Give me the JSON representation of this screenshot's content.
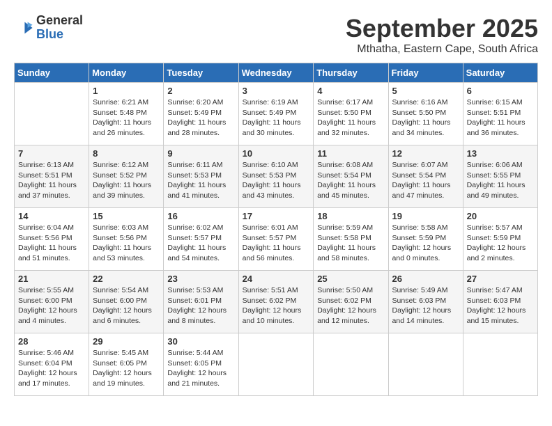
{
  "header": {
    "logo_general": "General",
    "logo_blue": "Blue",
    "month": "September 2025",
    "location": "Mthatha, Eastern Cape, South Africa"
  },
  "weekdays": [
    "Sunday",
    "Monday",
    "Tuesday",
    "Wednesday",
    "Thursday",
    "Friday",
    "Saturday"
  ],
  "weeks": [
    [
      {
        "day": "",
        "info": ""
      },
      {
        "day": "1",
        "info": "Sunrise: 6:21 AM\nSunset: 5:48 PM\nDaylight: 11 hours\nand 26 minutes."
      },
      {
        "day": "2",
        "info": "Sunrise: 6:20 AM\nSunset: 5:49 PM\nDaylight: 11 hours\nand 28 minutes."
      },
      {
        "day": "3",
        "info": "Sunrise: 6:19 AM\nSunset: 5:49 PM\nDaylight: 11 hours\nand 30 minutes."
      },
      {
        "day": "4",
        "info": "Sunrise: 6:17 AM\nSunset: 5:50 PM\nDaylight: 11 hours\nand 32 minutes."
      },
      {
        "day": "5",
        "info": "Sunrise: 6:16 AM\nSunset: 5:50 PM\nDaylight: 11 hours\nand 34 minutes."
      },
      {
        "day": "6",
        "info": "Sunrise: 6:15 AM\nSunset: 5:51 PM\nDaylight: 11 hours\nand 36 minutes."
      }
    ],
    [
      {
        "day": "7",
        "info": "Sunrise: 6:13 AM\nSunset: 5:51 PM\nDaylight: 11 hours\nand 37 minutes."
      },
      {
        "day": "8",
        "info": "Sunrise: 6:12 AM\nSunset: 5:52 PM\nDaylight: 11 hours\nand 39 minutes."
      },
      {
        "day": "9",
        "info": "Sunrise: 6:11 AM\nSunset: 5:53 PM\nDaylight: 11 hours\nand 41 minutes."
      },
      {
        "day": "10",
        "info": "Sunrise: 6:10 AM\nSunset: 5:53 PM\nDaylight: 11 hours\nand 43 minutes."
      },
      {
        "day": "11",
        "info": "Sunrise: 6:08 AM\nSunset: 5:54 PM\nDaylight: 11 hours\nand 45 minutes."
      },
      {
        "day": "12",
        "info": "Sunrise: 6:07 AM\nSunset: 5:54 PM\nDaylight: 11 hours\nand 47 minutes."
      },
      {
        "day": "13",
        "info": "Sunrise: 6:06 AM\nSunset: 5:55 PM\nDaylight: 11 hours\nand 49 minutes."
      }
    ],
    [
      {
        "day": "14",
        "info": "Sunrise: 6:04 AM\nSunset: 5:56 PM\nDaylight: 11 hours\nand 51 minutes."
      },
      {
        "day": "15",
        "info": "Sunrise: 6:03 AM\nSunset: 5:56 PM\nDaylight: 11 hours\nand 53 minutes."
      },
      {
        "day": "16",
        "info": "Sunrise: 6:02 AM\nSunset: 5:57 PM\nDaylight: 11 hours\nand 54 minutes."
      },
      {
        "day": "17",
        "info": "Sunrise: 6:01 AM\nSunset: 5:57 PM\nDaylight: 11 hours\nand 56 minutes."
      },
      {
        "day": "18",
        "info": "Sunrise: 5:59 AM\nSunset: 5:58 PM\nDaylight: 11 hours\nand 58 minutes."
      },
      {
        "day": "19",
        "info": "Sunrise: 5:58 AM\nSunset: 5:59 PM\nDaylight: 12 hours\nand 0 minutes."
      },
      {
        "day": "20",
        "info": "Sunrise: 5:57 AM\nSunset: 5:59 PM\nDaylight: 12 hours\nand 2 minutes."
      }
    ],
    [
      {
        "day": "21",
        "info": "Sunrise: 5:55 AM\nSunset: 6:00 PM\nDaylight: 12 hours\nand 4 minutes."
      },
      {
        "day": "22",
        "info": "Sunrise: 5:54 AM\nSunset: 6:00 PM\nDaylight: 12 hours\nand 6 minutes."
      },
      {
        "day": "23",
        "info": "Sunrise: 5:53 AM\nSunset: 6:01 PM\nDaylight: 12 hours\nand 8 minutes."
      },
      {
        "day": "24",
        "info": "Sunrise: 5:51 AM\nSunset: 6:02 PM\nDaylight: 12 hours\nand 10 minutes."
      },
      {
        "day": "25",
        "info": "Sunrise: 5:50 AM\nSunset: 6:02 PM\nDaylight: 12 hours\nand 12 minutes."
      },
      {
        "day": "26",
        "info": "Sunrise: 5:49 AM\nSunset: 6:03 PM\nDaylight: 12 hours\nand 14 minutes."
      },
      {
        "day": "27",
        "info": "Sunrise: 5:47 AM\nSunset: 6:03 PM\nDaylight: 12 hours\nand 15 minutes."
      }
    ],
    [
      {
        "day": "28",
        "info": "Sunrise: 5:46 AM\nSunset: 6:04 PM\nDaylight: 12 hours\nand 17 minutes."
      },
      {
        "day": "29",
        "info": "Sunrise: 5:45 AM\nSunset: 6:05 PM\nDaylight: 12 hours\nand 19 minutes."
      },
      {
        "day": "30",
        "info": "Sunrise: 5:44 AM\nSunset: 6:05 PM\nDaylight: 12 hours\nand 21 minutes."
      },
      {
        "day": "",
        "info": ""
      },
      {
        "day": "",
        "info": ""
      },
      {
        "day": "",
        "info": ""
      },
      {
        "day": "",
        "info": ""
      }
    ]
  ]
}
